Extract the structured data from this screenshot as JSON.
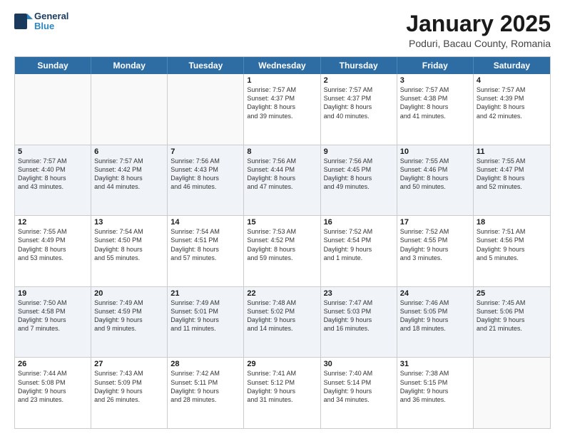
{
  "logo": {
    "line1": "General",
    "line2": "Blue"
  },
  "title": "January 2025",
  "location": "Poduri, Bacau County, Romania",
  "header": {
    "days": [
      "Sunday",
      "Monday",
      "Tuesday",
      "Wednesday",
      "Thursday",
      "Friday",
      "Saturday"
    ]
  },
  "weeks": [
    [
      {
        "day": "",
        "text": ""
      },
      {
        "day": "",
        "text": ""
      },
      {
        "day": "",
        "text": ""
      },
      {
        "day": "1",
        "text": "Sunrise: 7:57 AM\nSunset: 4:37 PM\nDaylight: 8 hours\nand 39 minutes."
      },
      {
        "day": "2",
        "text": "Sunrise: 7:57 AM\nSunset: 4:37 PM\nDaylight: 8 hours\nand 40 minutes."
      },
      {
        "day": "3",
        "text": "Sunrise: 7:57 AM\nSunset: 4:38 PM\nDaylight: 8 hours\nand 41 minutes."
      },
      {
        "day": "4",
        "text": "Sunrise: 7:57 AM\nSunset: 4:39 PM\nDaylight: 8 hours\nand 42 minutes."
      }
    ],
    [
      {
        "day": "5",
        "text": "Sunrise: 7:57 AM\nSunset: 4:40 PM\nDaylight: 8 hours\nand 43 minutes."
      },
      {
        "day": "6",
        "text": "Sunrise: 7:57 AM\nSunset: 4:42 PM\nDaylight: 8 hours\nand 44 minutes."
      },
      {
        "day": "7",
        "text": "Sunrise: 7:56 AM\nSunset: 4:43 PM\nDaylight: 8 hours\nand 46 minutes."
      },
      {
        "day": "8",
        "text": "Sunrise: 7:56 AM\nSunset: 4:44 PM\nDaylight: 8 hours\nand 47 minutes."
      },
      {
        "day": "9",
        "text": "Sunrise: 7:56 AM\nSunset: 4:45 PM\nDaylight: 8 hours\nand 49 minutes."
      },
      {
        "day": "10",
        "text": "Sunrise: 7:55 AM\nSunset: 4:46 PM\nDaylight: 8 hours\nand 50 minutes."
      },
      {
        "day": "11",
        "text": "Sunrise: 7:55 AM\nSunset: 4:47 PM\nDaylight: 8 hours\nand 52 minutes."
      }
    ],
    [
      {
        "day": "12",
        "text": "Sunrise: 7:55 AM\nSunset: 4:49 PM\nDaylight: 8 hours\nand 53 minutes."
      },
      {
        "day": "13",
        "text": "Sunrise: 7:54 AM\nSunset: 4:50 PM\nDaylight: 8 hours\nand 55 minutes."
      },
      {
        "day": "14",
        "text": "Sunrise: 7:54 AM\nSunset: 4:51 PM\nDaylight: 8 hours\nand 57 minutes."
      },
      {
        "day": "15",
        "text": "Sunrise: 7:53 AM\nSunset: 4:52 PM\nDaylight: 8 hours\nand 59 minutes."
      },
      {
        "day": "16",
        "text": "Sunrise: 7:52 AM\nSunset: 4:54 PM\nDaylight: 9 hours\nand 1 minute."
      },
      {
        "day": "17",
        "text": "Sunrise: 7:52 AM\nSunset: 4:55 PM\nDaylight: 9 hours\nand 3 minutes."
      },
      {
        "day": "18",
        "text": "Sunrise: 7:51 AM\nSunset: 4:56 PM\nDaylight: 9 hours\nand 5 minutes."
      }
    ],
    [
      {
        "day": "19",
        "text": "Sunrise: 7:50 AM\nSunset: 4:58 PM\nDaylight: 9 hours\nand 7 minutes."
      },
      {
        "day": "20",
        "text": "Sunrise: 7:49 AM\nSunset: 4:59 PM\nDaylight: 9 hours\nand 9 minutes."
      },
      {
        "day": "21",
        "text": "Sunrise: 7:49 AM\nSunset: 5:01 PM\nDaylight: 9 hours\nand 11 minutes."
      },
      {
        "day": "22",
        "text": "Sunrise: 7:48 AM\nSunset: 5:02 PM\nDaylight: 9 hours\nand 14 minutes."
      },
      {
        "day": "23",
        "text": "Sunrise: 7:47 AM\nSunset: 5:03 PM\nDaylight: 9 hours\nand 16 minutes."
      },
      {
        "day": "24",
        "text": "Sunrise: 7:46 AM\nSunset: 5:05 PM\nDaylight: 9 hours\nand 18 minutes."
      },
      {
        "day": "25",
        "text": "Sunrise: 7:45 AM\nSunset: 5:06 PM\nDaylight: 9 hours\nand 21 minutes."
      }
    ],
    [
      {
        "day": "26",
        "text": "Sunrise: 7:44 AM\nSunset: 5:08 PM\nDaylight: 9 hours\nand 23 minutes."
      },
      {
        "day": "27",
        "text": "Sunrise: 7:43 AM\nSunset: 5:09 PM\nDaylight: 9 hours\nand 26 minutes."
      },
      {
        "day": "28",
        "text": "Sunrise: 7:42 AM\nSunset: 5:11 PM\nDaylight: 9 hours\nand 28 minutes."
      },
      {
        "day": "29",
        "text": "Sunrise: 7:41 AM\nSunset: 5:12 PM\nDaylight: 9 hours\nand 31 minutes."
      },
      {
        "day": "30",
        "text": "Sunrise: 7:40 AM\nSunset: 5:14 PM\nDaylight: 9 hours\nand 34 minutes."
      },
      {
        "day": "31",
        "text": "Sunrise: 7:38 AM\nSunset: 5:15 PM\nDaylight: 9 hours\nand 36 minutes."
      },
      {
        "day": "",
        "text": ""
      }
    ]
  ]
}
